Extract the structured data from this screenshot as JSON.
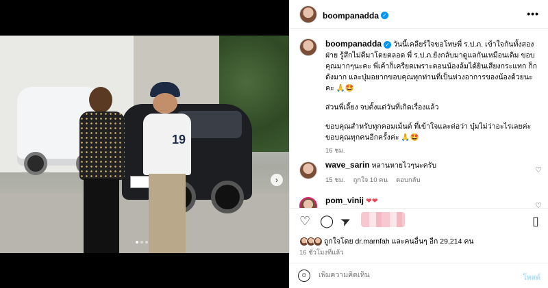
{
  "post": {
    "username": "boompanadda",
    "verified_mark": "✓",
    "more_icon": "•••",
    "carousel_next": "›"
  },
  "caption": {
    "username": "boompanadda",
    "para1": "วันนี้เคลียร์ใจขอโทษพี่ ร.ป.ภ. เข้าใจกันทั้งสองฝ่าย รู้สึกไม่ดีมาโดยตลอด พี่ ร.ป.ภ.ยังกลับมาดูแลกันเหมือนเดิม ขอบคุณมากๆนะคะ พี่เค้าก็เครียดเพราะตอนน้องล้มได้ยินเสียงกระแทก ก็ก ดังมาก และบุ๋มอยากขอบคุณทุกท่านที่เป็นห่วงอาการของน้องด้วยนะคะ 🙏🤩",
    "para2": "ส่วนพี่เลี้ยง จบตั้งแต่วันที่เกิดเรื่องแล้ว",
    "para3": "ขอบคุณสำหรับทุกคอมเม้นต์ ที่เข้าใจและต่อว่า บุ๋มไม่ว่าอะไรเลยค่ะ ขอบคุณทุกคนอีกครั้งค่ะ 🙏🤩",
    "time": "16 ชม."
  },
  "comments": [
    {
      "username": "wave_sarin",
      "text": "หลานหายไวๆนะครับ",
      "time": "15 ชม.",
      "likes": "ถูกใจ 10 คน",
      "reply": "ตอบกลับ"
    },
    {
      "username": "pom_vinij",
      "text": "❤❤"
    }
  ],
  "actions": {
    "like_icon": "♡",
    "comment_icon": "◯",
    "share_icon": "➤",
    "save_icon": "▯"
  },
  "likes": {
    "text": "ถูกใจโดย dr.marnfah และคนอื่นๆ อีก 29,214 คน"
  },
  "post_time": "16 ชั่วโมงที่แล้ว",
  "add_comment": {
    "placeholder": "เพิ่มความคิดเห็น",
    "post_label": "โพสต์",
    "emoji_icon": "☺"
  },
  "colors": {
    "verified": "#0095f6",
    "heart_red": "#ed4956",
    "muted": "#737373"
  }
}
